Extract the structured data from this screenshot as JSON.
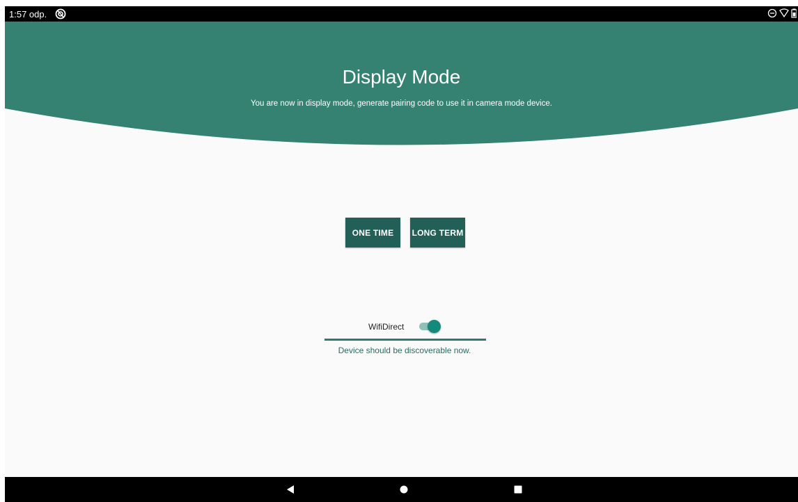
{
  "status_bar": {
    "time": "1:57 odp."
  },
  "header": {
    "title": "Display Mode",
    "subtitle": "You are now in display mode, generate pairing code to use it in camera mode device."
  },
  "buttons": {
    "one_time": "ONE TIME",
    "long_term": "LONG TERM"
  },
  "wifi": {
    "label": "WifiDirect",
    "enabled": true,
    "status_message": "Device should be discoverable now."
  },
  "colors": {
    "header_bg": "#358172",
    "button_bg": "#225f56",
    "toggle_thumb": "#15897a",
    "toggle_track": "#8fc1b7",
    "background": "#fafafa"
  },
  "icons": {
    "status_app": "do-not-disturb-app-icon",
    "status_dnd": "minus-circle-icon",
    "status_wifi": "wifi-icon",
    "status_battery": "battery-icon",
    "nav_back": "back-triangle-icon",
    "nav_home": "home-circle-icon",
    "nav_recents": "recents-square-icon"
  }
}
